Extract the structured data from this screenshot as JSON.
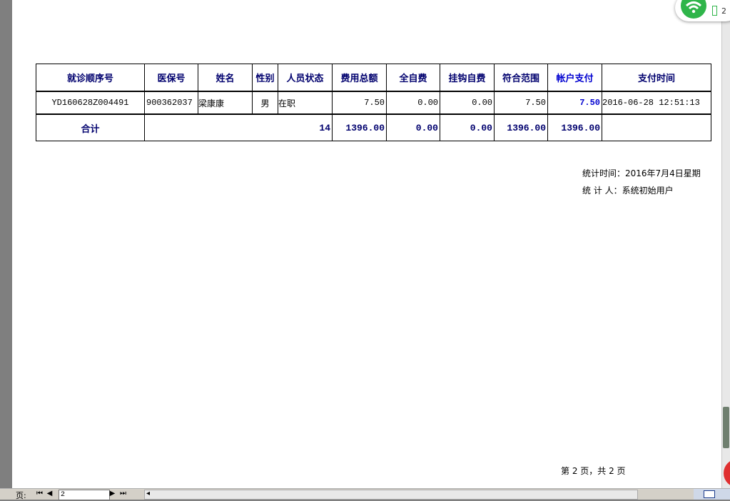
{
  "table": {
    "headers": [
      "就诊顺序号",
      "医保号",
      "姓名",
      "性别",
      "人员状态",
      "费用总额",
      "全自费",
      "挂钩自费",
      "符合范围",
      "帐户支付",
      "支付时间"
    ],
    "rows": [
      {
        "visit_no": "YD160628Z004491",
        "insurance_no": "900362037",
        "name": "梁康康",
        "gender": "男",
        "status": "在职",
        "total_fee": "7.50",
        "self_pay": "0.00",
        "linked_self_pay": "0.00",
        "in_scope": "7.50",
        "account_pay": "7.50",
        "pay_time": "2016-06-28 12:51:13"
      }
    ],
    "totals": {
      "label": "合计",
      "count": "14",
      "total_fee": "1396.00",
      "self_pay": "0.00",
      "linked_self_pay": "0.00",
      "in_scope": "1396.00",
      "account_pay": "1396.00"
    }
  },
  "footer": {
    "stat_time": "统计时间：2016年7月4日星期",
    "stat_person": "统 计 人：系统初始用户",
    "page_info": "第 2 页，共 2 页"
  },
  "statusbar": {
    "page_label": "页:",
    "page_value": "2"
  },
  "tray": {
    "battery_number": "2"
  },
  "colors": {
    "header_text": "#00006e",
    "account_pay_text": "#0000d0",
    "wifi": "#2fb54a"
  }
}
